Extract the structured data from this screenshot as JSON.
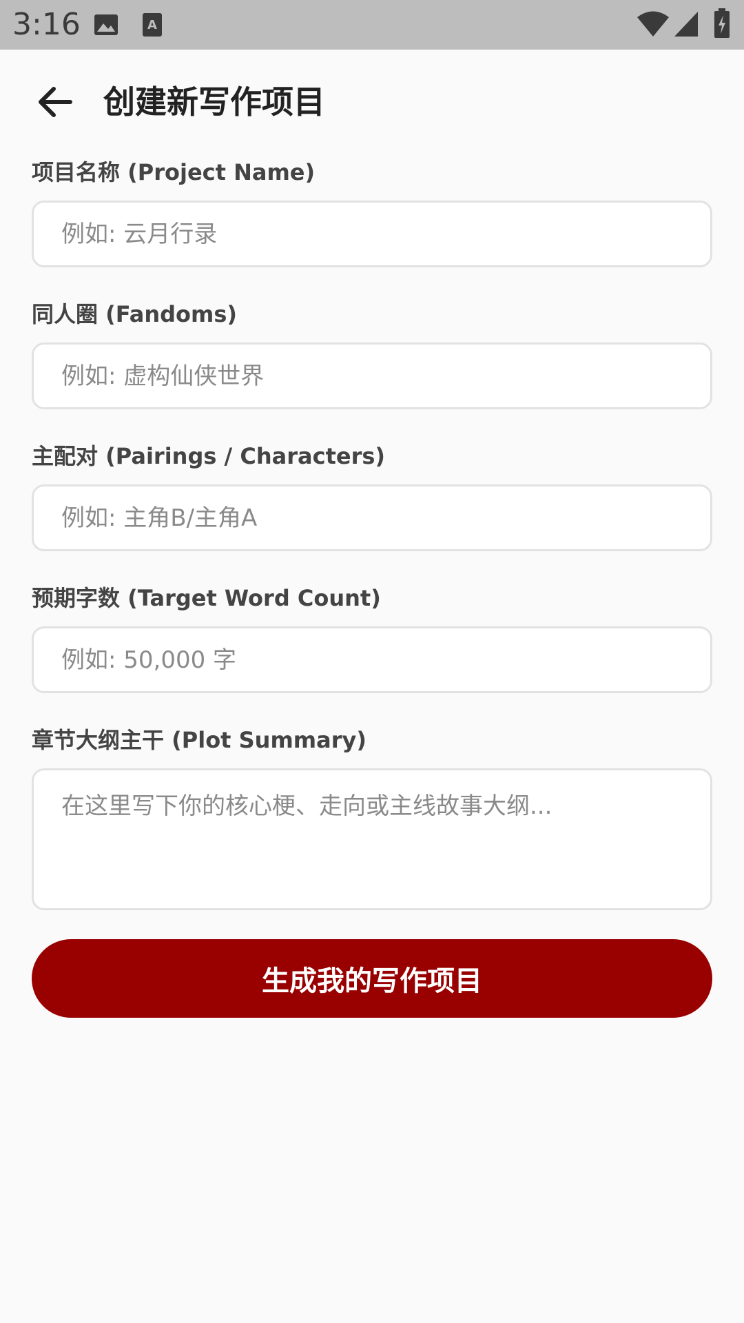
{
  "status_bar": {
    "time": "3:16",
    "icons": [
      "image-icon",
      "text-badge-icon",
      "wifi-icon",
      "signal-icon",
      "battery-icon"
    ],
    "background": "#bdbdbd"
  },
  "header": {
    "title": "创建新写作项目",
    "back_icon": "arrow-left-icon"
  },
  "form": {
    "project_name": {
      "label": "项目名称 (Project Name)",
      "placeholder": "例如: 云月行录",
      "value": ""
    },
    "fandoms": {
      "label": "同人圈 (Fandoms)",
      "placeholder": "例如: 虚构仙侠世界",
      "value": ""
    },
    "pairings": {
      "label": "主配对 (Pairings / Characters)",
      "placeholder": "例如: 主角B/主角A",
      "value": ""
    },
    "word_count": {
      "label": "预期字数 (Target Word Count)",
      "placeholder": "例如: 50,000 字",
      "value": ""
    },
    "plot_summary": {
      "label": "章节大纲主干 (Plot Summary)",
      "placeholder": "在这里写下你的核心梗、走向或主线故事大纲...",
      "value": ""
    },
    "submit_label": "生成我的写作项目"
  },
  "colors": {
    "accent": "#990000",
    "background": "#fafafa",
    "field_border": "#e2e2e2"
  }
}
